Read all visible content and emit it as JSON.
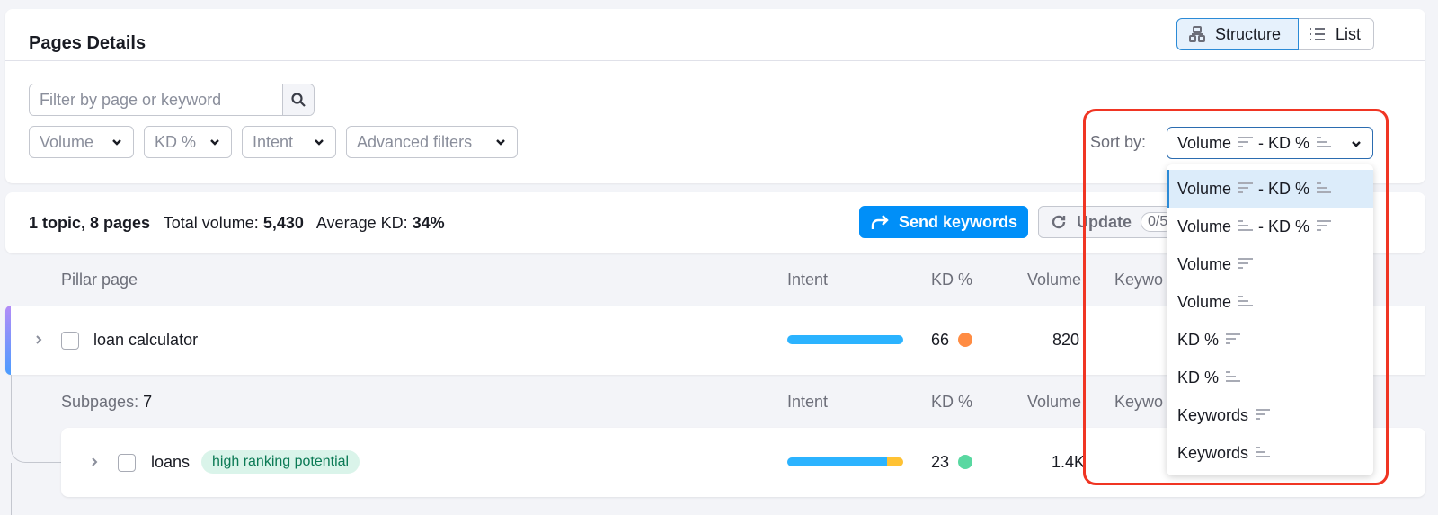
{
  "header": {
    "title": "Pages Details",
    "view_toggle": [
      {
        "label": "Structure",
        "icon": "structure-icon",
        "active": true
      },
      {
        "label": "List",
        "icon": "list-icon",
        "active": false
      }
    ]
  },
  "filters": {
    "search_placeholder": "Filter by page or keyword",
    "search_value": "",
    "buttons": [
      {
        "label": "Volume"
      },
      {
        "label": "KD %"
      },
      {
        "label": "Intent"
      },
      {
        "label": "Advanced filters"
      }
    ],
    "sort_label": "Sort by:",
    "sort_selected": {
      "part1": "Volume",
      "dir1": "desc",
      "sep": "- KD %",
      "dir2": "asc"
    }
  },
  "sort_options": [
    {
      "label": "Volume",
      "dir": "desc",
      "label2": "- KD %",
      "dir2": "asc",
      "selected": true
    },
    {
      "label": "Volume",
      "dir": "asc",
      "label2": "- KD %",
      "dir2": "desc",
      "selected": false
    },
    {
      "label": "Volume",
      "dir": "desc",
      "selected": false
    },
    {
      "label": "Volume",
      "dir": "asc",
      "selected": false
    },
    {
      "label": "KD %",
      "dir": "desc",
      "selected": false
    },
    {
      "label": "KD %",
      "dir": "asc",
      "selected": false
    },
    {
      "label": "Keywords",
      "dir": "desc",
      "selected": false
    },
    {
      "label": "Keywords",
      "dir": "asc",
      "selected": false
    }
  ],
  "summary": {
    "topics_pages": "1 topic, 8 pages",
    "total_volume_label": "Total volume:",
    "total_volume": "5,430",
    "avg_kd_label": "Average KD:",
    "avg_kd": "34%",
    "send_button": "Send keywords",
    "update_button": "Update",
    "update_count": "0/5"
  },
  "pillar": {
    "section_label": "Pillar page",
    "columns": {
      "intent": "Intent",
      "kd": "KD %",
      "volume": "Volume",
      "keywords": "Keywo"
    },
    "row": {
      "name": "loan calculator",
      "kd": "66",
      "kd_color": "#ff8c43",
      "volume": "820",
      "intent_segments": [
        {
          "fraction": 1.0,
          "color": "#2bb3ff"
        }
      ]
    }
  },
  "subpages": {
    "section_label": "Subpages:",
    "count": "7",
    "columns": {
      "intent": "Intent",
      "kd": "KD %",
      "volume": "Volume",
      "keywords": "Keywo"
    },
    "rows": [
      {
        "name": "loans",
        "badge": "high ranking potential",
        "kd": "23",
        "kd_color": "#59d8a1",
        "volume": "1.4K",
        "intent_segments": [
          {
            "fraction": 0.86,
            "color": "#2bb3ff"
          },
          {
            "fraction": 0.14,
            "color": "#ffc233"
          }
        ]
      }
    ]
  }
}
